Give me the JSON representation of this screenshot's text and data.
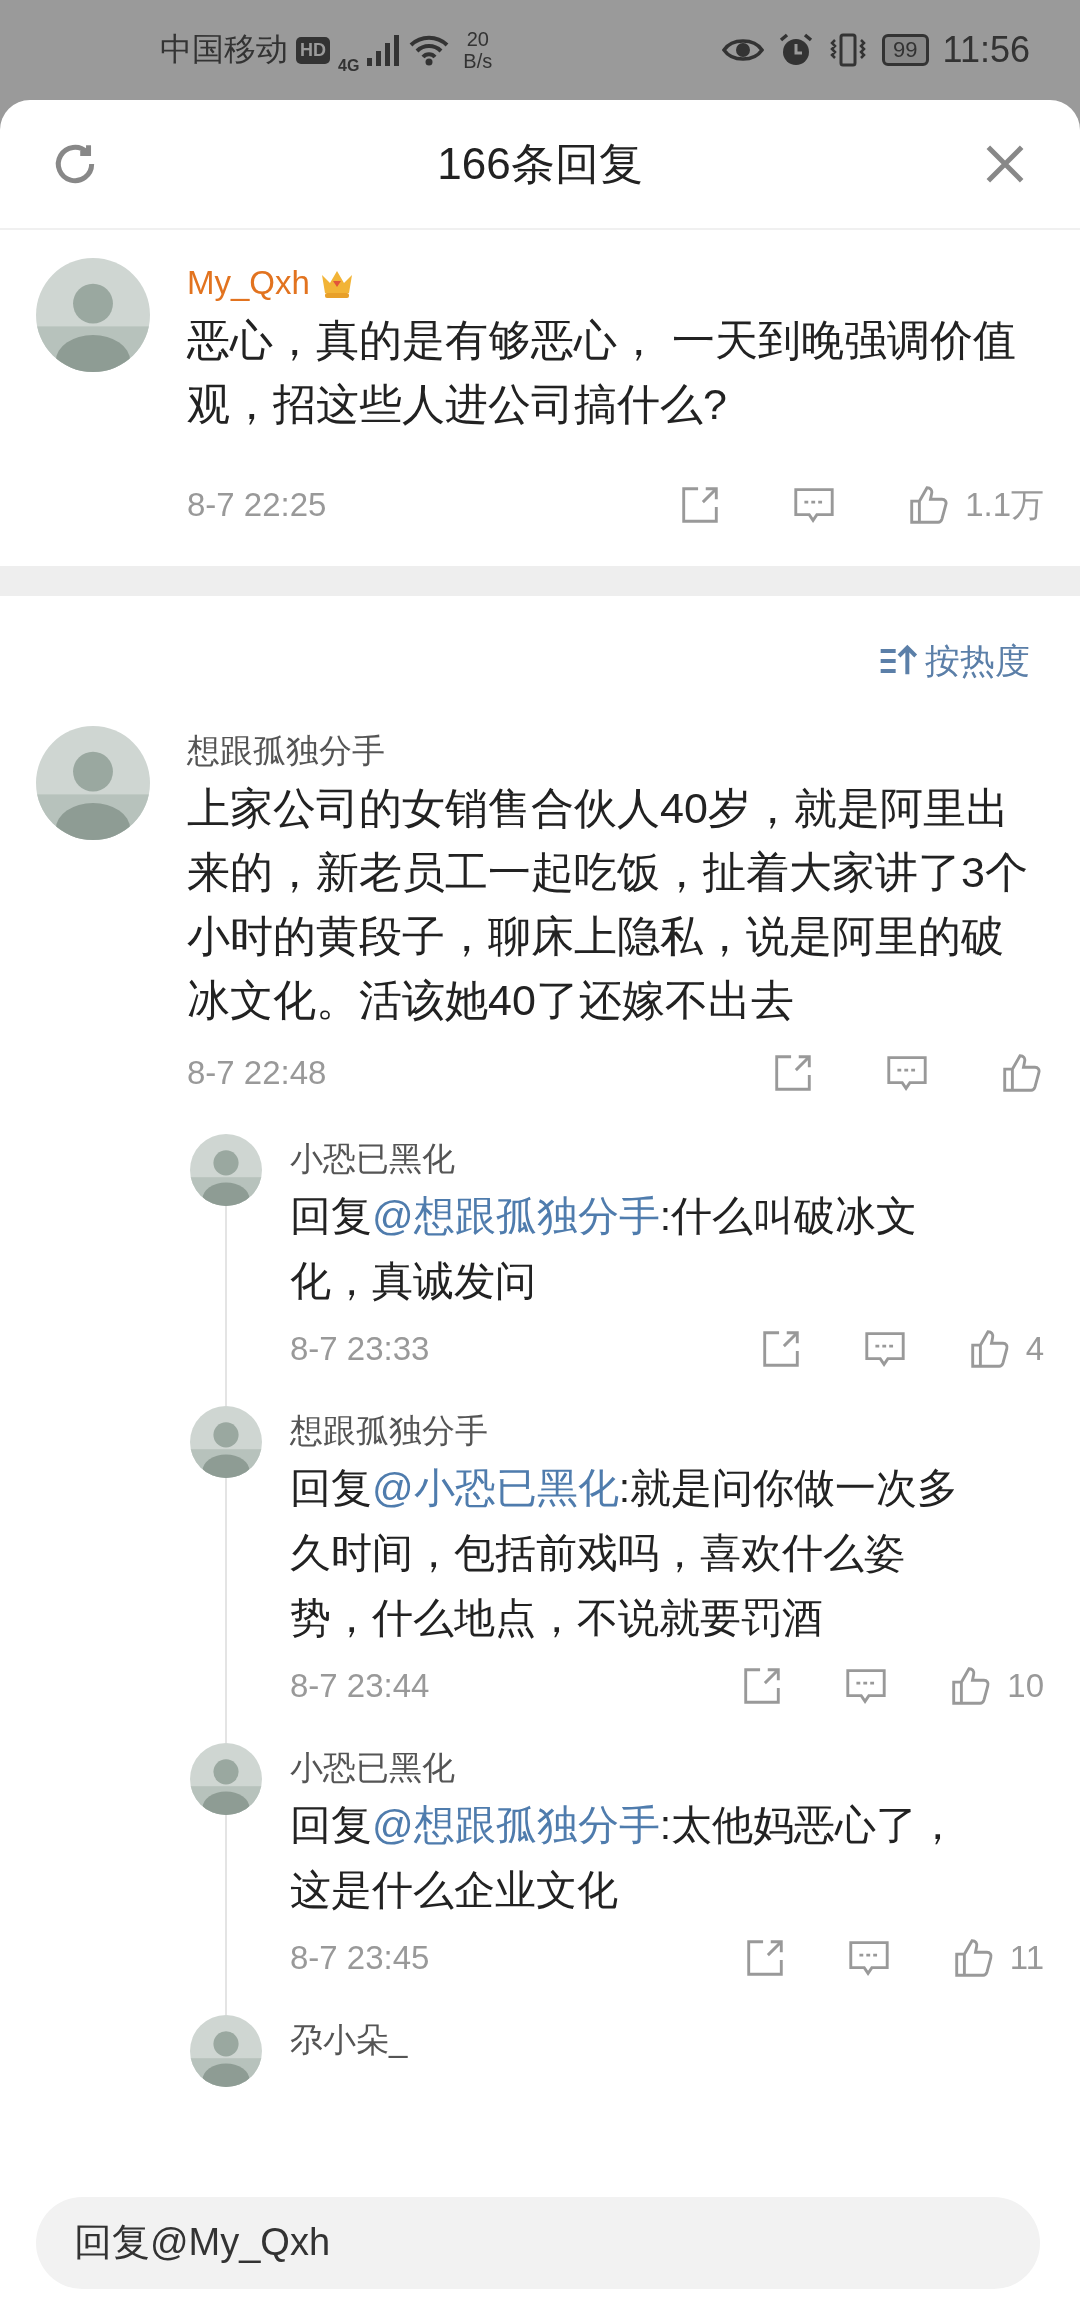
{
  "status_bar": {
    "carrier": "中国移动",
    "hd": "HD",
    "network": "4G",
    "speed_value": "20",
    "speed_unit": "B/s",
    "battery": "99",
    "time": "11:56"
  },
  "header": {
    "title": "166条回复"
  },
  "main_comment": {
    "user": "My_Qxh",
    "crown_badge": true,
    "text": "恶心，真的是有够恶心， 一天到晚强调价值观，招这些人进公司搞什么?",
    "time": "8-7 22:25",
    "like_count": "1.1万"
  },
  "sort": {
    "label": "按热度"
  },
  "comments": [
    {
      "user": "想跟孤独分手",
      "text": "上家公司的女销售合伙人40岁，就是阿里出来的，新老员工一起吃饭，扯着大家讲了3个小时的黄段子，聊床上隐私，说是阿里的破冰文化。活该她40了还嫁不出去",
      "time": "8-7 22:48",
      "replies": [
        {
          "user": "小恐已黑化",
          "prefix": "回复",
          "mention": "@想跟孤独分手",
          "text": ":什么叫破冰文化，真诚发问",
          "time": "8-7 23:33",
          "like_count": "4"
        },
        {
          "user": "想跟孤独分手",
          "prefix": "回复",
          "mention": "@小恐已黑化",
          "text": ":就是问你做一次多久时间，包括前戏吗，喜欢什么姿势，什么地点，不说就要罚酒",
          "time": "8-7 23:44",
          "like_count": "10"
        },
        {
          "user": "小恐已黑化",
          "prefix": "回复",
          "mention": "@想跟孤独分手",
          "text": ":太他妈恶心了，这是什么企业文化",
          "time": "8-7 23:45",
          "like_count": "11"
        },
        {
          "user": "尕小朵_"
        }
      ]
    }
  ],
  "reply_field": {
    "placeholder": "回复@My_Qxh"
  }
}
